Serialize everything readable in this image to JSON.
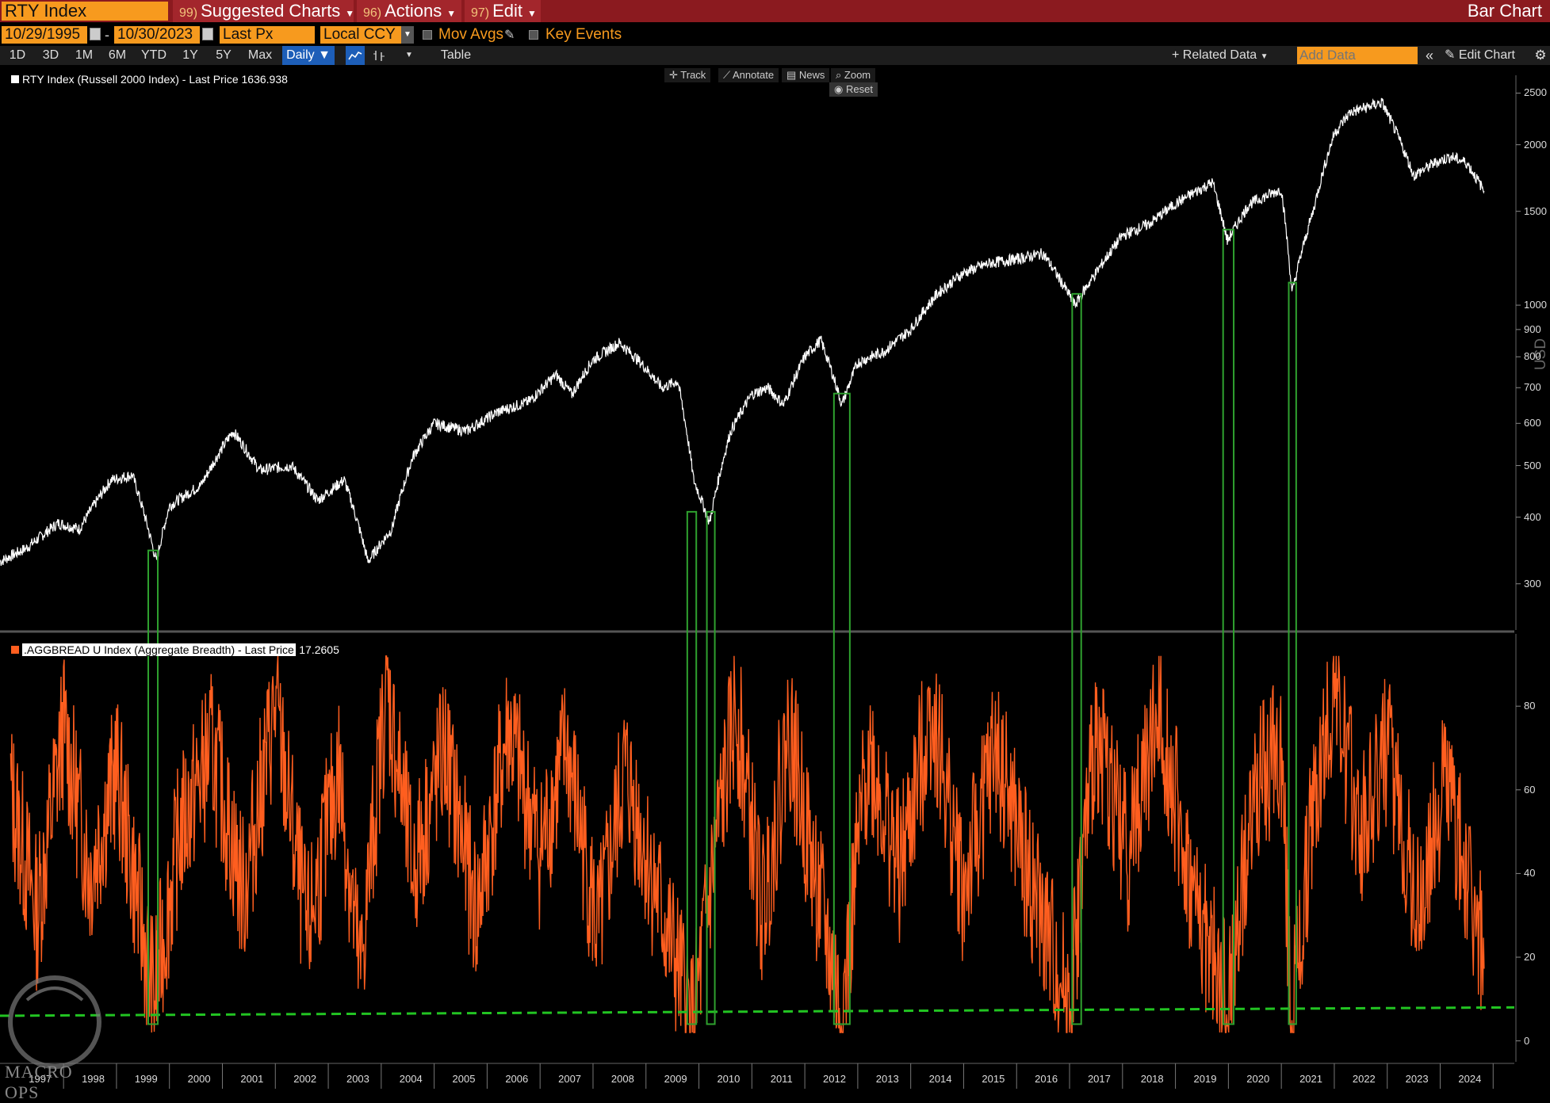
{
  "toolbar": {
    "security": "RTY Index",
    "menus": [
      {
        "num": "99)",
        "label": "Suggested Charts"
      },
      {
        "num": "96)",
        "label": "Actions"
      },
      {
        "num": "97)",
        "label": "Edit"
      }
    ],
    "title": "Bar Chart"
  },
  "settings": {
    "start_date": "10/29/1995",
    "dash": "-",
    "end_date": "10/30/2023",
    "price_field": "Last Px",
    "currency": "Local CCY",
    "mov_avgs": "Mov Avgs",
    "key_events": "Key Events"
  },
  "ranges": [
    "1D",
    "3D",
    "1M",
    "6M",
    "YTD",
    "1Y",
    "5Y",
    "Max"
  ],
  "period": "Daily",
  "table_label": "Table",
  "related_data": "Related Data",
  "add_data_placeholder": "Add Data",
  "edit_chart": "Edit Chart",
  "tools": [
    "Track",
    "Annotate",
    "News",
    "Zoom"
  ],
  "reset": "Reset",
  "top_panel": {
    "legend": "RTY Index (Russell 2000 Index) - Last Price 1636.938",
    "axis_ticks": [
      "2500",
      "2000",
      "1500",
      "1000",
      "900",
      "800",
      "700",
      "600",
      "500",
      "400",
      "300"
    ],
    "side_label": "USD"
  },
  "bottom_panel": {
    "legend": ".AGGBREAD U Index (Aggregate Breadth) - Last Price",
    "legend_value": "17.2605",
    "axis_ticks": [
      "80",
      "60",
      "40",
      "20",
      "0"
    ]
  },
  "x_axis_years": [
    "1997",
    "1998",
    "1999",
    "2000",
    "2001",
    "2002",
    "2003",
    "2004",
    "2005",
    "2006",
    "2007",
    "2008",
    "2009",
    "2010",
    "2011",
    "2012",
    "2013",
    "2014",
    "2015",
    "2016",
    "2017",
    "2018",
    "2019",
    "2020",
    "2021",
    "2022",
    "2023",
    "2024"
  ],
  "watermark": "MACRO OPS",
  "colors": {
    "brand_bar": "#8b1a1f",
    "field_orange": "#f79a1e",
    "price_line": "#ffffff",
    "breadth_line": "#ff5e1f",
    "highlight_box": "#2fa12f",
    "threshold_line": "#22c422"
  },
  "chart_data": [
    {
      "type": "line",
      "title": "RTY Index (Russell 2000 Index) - Last Price 1636.938",
      "scale": "log",
      "ylim": [
        250,
        2700
      ],
      "x": [
        1995.8,
        1996.3,
        1996.9,
        1997.3,
        1997.9,
        1998.3,
        1998.75,
        1999.0,
        1999.6,
        2000.2,
        2000.7,
        2001.3,
        2001.8,
        2002.3,
        2002.75,
        2003.2,
        2003.6,
        2004.0,
        2004.6,
        2005.2,
        2005.8,
        2006.3,
        2006.6,
        2007.0,
        2007.5,
        2007.9,
        2008.3,
        2008.6,
        2008.9,
        2009.2,
        2009.6,
        2010.0,
        2010.3,
        2010.6,
        2011.0,
        2011.3,
        2011.7,
        2012.0,
        2012.5,
        2013.0,
        2013.5,
        2014.0,
        2014.5,
        2015.0,
        2015.5,
        2016.1,
        2016.5,
        2017.0,
        2017.5,
        2018.0,
        2018.7,
        2018.98,
        2019.4,
        2020.0,
        2020.2,
        2020.6,
        2021.0,
        2021.3,
        2021.9,
        2022.5,
        2022.9,
        2023.2,
        2023.5,
        2023.83
      ],
      "y": [
        330,
        350,
        390,
        380,
        470,
        480,
        330,
        420,
        460,
        580,
        490,
        500,
        430,
        470,
        330,
        380,
        520,
        600,
        580,
        630,
        660,
        740,
        680,
        790,
        850,
        780,
        700,
        720,
        470,
        390,
        580,
        680,
        700,
        650,
        800,
        860,
        650,
        780,
        820,
        900,
        1050,
        1150,
        1200,
        1220,
        1250,
        1000,
        1150,
        1350,
        1420,
        1550,
        1700,
        1320,
        1550,
        1650,
        1050,
        1500,
        2100,
        2300,
        2400,
        1750,
        1850,
        1900,
        1850,
        1636.938
      ]
    },
    {
      "type": "line",
      "title": ".AGGBREAD U Index (Aggregate Breadth) - Last Price 17.2605",
      "ylim": [
        -5,
        95
      ],
      "x": [
        1996.0,
        1996.5,
        1997.0,
        1997.5,
        1998.0,
        1998.7,
        1999.2,
        1999.8,
        2000.4,
        2001.0,
        2001.6,
        2002.2,
        2002.6,
        2003.1,
        2003.6,
        2004.2,
        2004.8,
        2005.4,
        2006.0,
        2006.5,
        2007.1,
        2007.6,
        2008.2,
        2008.9,
        2009.3,
        2009.7,
        2010.2,
        2010.7,
        2011.1,
        2011.7,
        2012.2,
        2012.8,
        2013.4,
        2014.0,
        2014.6,
        2015.2,
        2016.0,
        2016.5,
        2017.1,
        2017.7,
        2018.3,
        2018.98,
        2019.5,
        2020.0,
        2020.2,
        2020.6,
        2021.0,
        2021.5,
        2022.0,
        2022.6,
        2023.1,
        2023.83
      ],
      "y": [
        60,
        30,
        75,
        40,
        65,
        10,
        50,
        70,
        35,
        80,
        25,
        65,
        15,
        85,
        40,
        70,
        30,
        75,
        45,
        70,
        25,
        65,
        35,
        3,
        45,
        80,
        30,
        75,
        45,
        5,
        70,
        40,
        80,
        35,
        70,
        40,
        8,
        75,
        45,
        80,
        35,
        8,
        60,
        70,
        3,
        55,
        85,
        50,
        70,
        30,
        65,
        17.2605
      ]
    }
  ],
  "highlight_windows": [
    {
      "x_start": 1998.6,
      "x_end": 1998.78
    },
    {
      "x_start": 2008.78,
      "x_end": 2008.95
    },
    {
      "x_start": 2009.15,
      "x_end": 2009.3
    },
    {
      "x_start": 2011.55,
      "x_end": 2011.85
    },
    {
      "x_start": 2016.05,
      "x_end": 2016.22
    },
    {
      "x_start": 2018.9,
      "x_end": 2019.1
    },
    {
      "x_start": 2020.14,
      "x_end": 2020.28
    }
  ]
}
